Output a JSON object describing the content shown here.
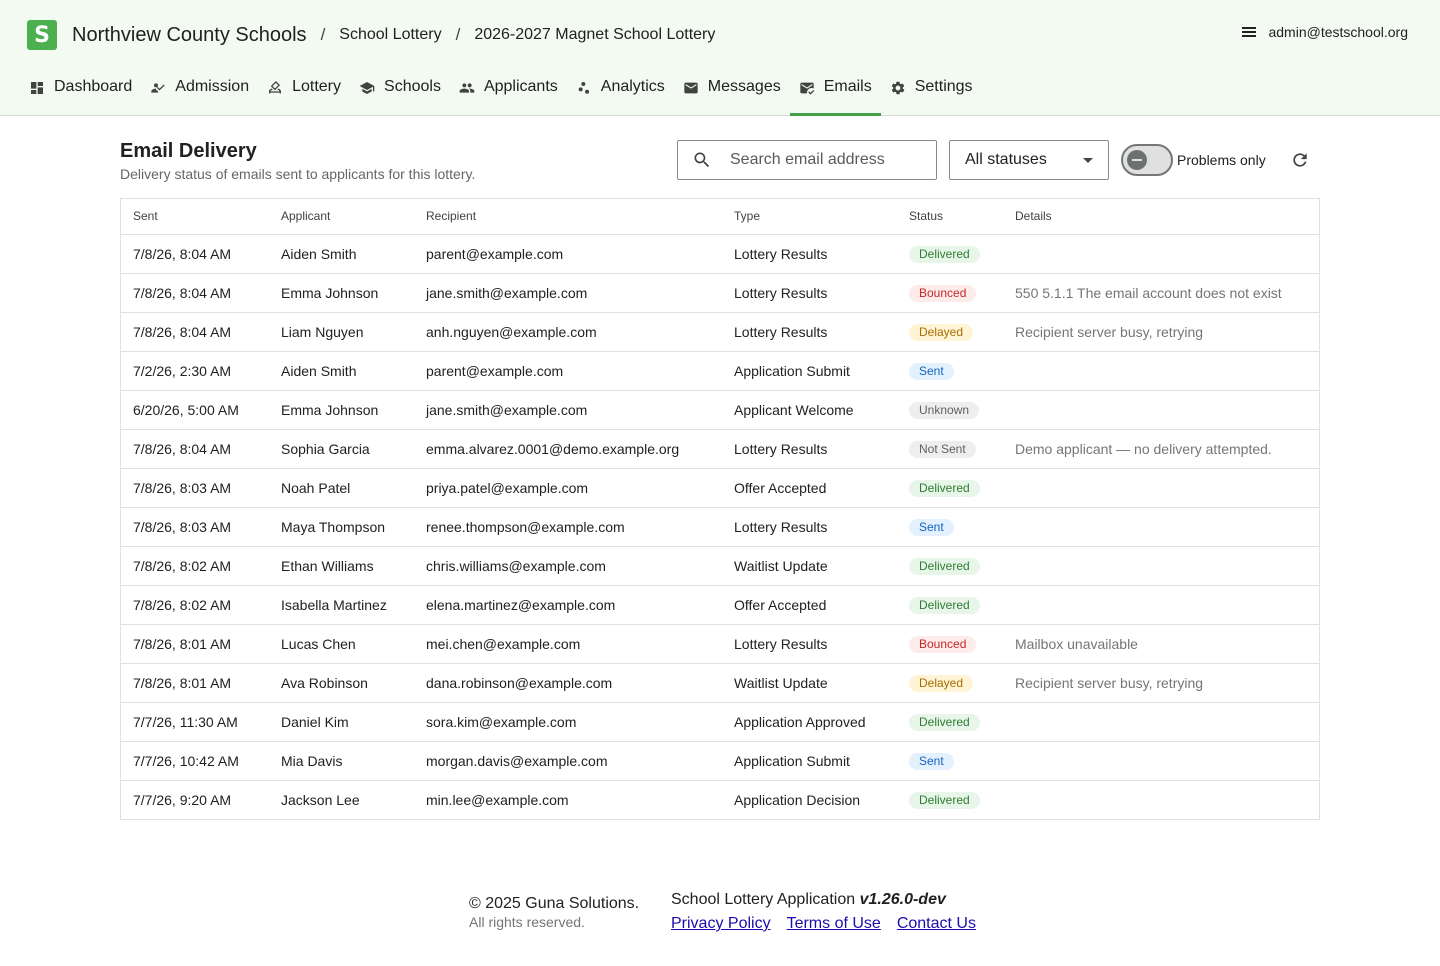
{
  "header": {
    "logo_letter": "S",
    "org_name": "Northview County Schools",
    "breadcrumb_sep": "/",
    "breadcrumbs": [
      "School Lottery",
      "2026-2027 Magnet School Lottery"
    ],
    "user_email": "admin@testschool.org"
  },
  "nav": {
    "items": [
      {
        "label": "Dashboard",
        "icon": "dashboard-icon"
      },
      {
        "label": "Admission",
        "icon": "admission-icon"
      },
      {
        "label": "Lottery",
        "icon": "lottery-icon"
      },
      {
        "label": "Schools",
        "icon": "school-icon"
      },
      {
        "label": "Applicants",
        "icon": "people-icon"
      },
      {
        "label": "Analytics",
        "icon": "analytics-icon"
      },
      {
        "label": "Messages",
        "icon": "mail-icon"
      },
      {
        "label": "Emails",
        "icon": "mark-email-read-icon"
      },
      {
        "label": "Settings",
        "icon": "gear-icon"
      }
    ],
    "active": "Emails",
    "active_color": "#43a047"
  },
  "main": {
    "title": "Email Delivery",
    "subtitle": "Delivery status of emails sent to applicants for this lottery.",
    "search_placeholder": "Search email address",
    "status_filter": "All statuses",
    "problems_only_label": "Problems only",
    "problems_only": false
  },
  "table": {
    "columns": [
      "Sent",
      "Applicant",
      "Recipient",
      "Type",
      "Status",
      "Details"
    ],
    "rows": [
      {
        "sent": "7/8/26, 8:04 AM",
        "applicant": "Aiden Smith",
        "recipient": "parent@example.com",
        "type": "Lottery Results",
        "status": "Delivered",
        "details": ""
      },
      {
        "sent": "7/8/26, 8:04 AM",
        "applicant": "Emma Johnson",
        "recipient": "jane.smith@example.com",
        "type": "Lottery Results",
        "status": "Bounced",
        "details": "550 5.1.1 The email account does not exist"
      },
      {
        "sent": "7/8/26, 8:04 AM",
        "applicant": "Liam Nguyen",
        "recipient": "anh.nguyen@example.com",
        "type": "Lottery Results",
        "status": "Delayed",
        "details": "Recipient server busy, retrying"
      },
      {
        "sent": "7/2/26, 2:30 AM",
        "applicant": "Aiden Smith",
        "recipient": "parent@example.com",
        "type": "Application Submit",
        "status": "Sent",
        "details": ""
      },
      {
        "sent": "6/20/26, 5:00 AM",
        "applicant": "Emma Johnson",
        "recipient": "jane.smith@example.com",
        "type": "Applicant Welcome",
        "status": "Unknown",
        "details": ""
      },
      {
        "sent": "7/8/26, 8:04 AM",
        "applicant": "Sophia Garcia",
        "recipient": "emma.alvarez.0001@demo.example.org",
        "type": "Lottery Results",
        "status": "Not Sent",
        "details": "Demo applicant — no delivery attempted."
      },
      {
        "sent": "7/8/26, 8:03 AM",
        "applicant": "Noah Patel",
        "recipient": "priya.patel@example.com",
        "type": "Offer Accepted",
        "status": "Delivered",
        "details": ""
      },
      {
        "sent": "7/8/26, 8:03 AM",
        "applicant": "Maya Thompson",
        "recipient": "renee.thompson@example.com",
        "type": "Lottery Results",
        "status": "Sent",
        "details": ""
      },
      {
        "sent": "7/8/26, 8:02 AM",
        "applicant": "Ethan Williams",
        "recipient": "chris.williams@example.com",
        "type": "Waitlist Update",
        "status": "Delivered",
        "details": ""
      },
      {
        "sent": "7/8/26, 8:02 AM",
        "applicant": "Isabella Martinez",
        "recipient": "elena.martinez@example.com",
        "type": "Offer Accepted",
        "status": "Delivered",
        "details": ""
      },
      {
        "sent": "7/8/26, 8:01 AM",
        "applicant": "Lucas Chen",
        "recipient": "mei.chen@example.com",
        "type": "Lottery Results",
        "status": "Bounced",
        "details": "Mailbox unavailable"
      },
      {
        "sent": "7/8/26, 8:01 AM",
        "applicant": "Ava Robinson",
        "recipient": "dana.robinson@example.com",
        "type": "Waitlist Update",
        "status": "Delayed",
        "details": "Recipient server busy, retrying"
      },
      {
        "sent": "7/7/26, 11:30 AM",
        "applicant": "Daniel Kim",
        "recipient": "sora.kim@example.com",
        "type": "Application Approved",
        "status": "Delivered",
        "details": ""
      },
      {
        "sent": "7/7/26, 10:42 AM",
        "applicant": "Mia Davis",
        "recipient": "morgan.davis@example.com",
        "type": "Application Submit",
        "status": "Sent",
        "details": ""
      },
      {
        "sent": "7/7/26, 9:20 AM",
        "applicant": "Jackson Lee",
        "recipient": "min.lee@example.com",
        "type": "Application Decision",
        "status": "Delivered",
        "details": ""
      }
    ],
    "status_colors": {
      "Delivered": {
        "bg": "#e8f5e9",
        "fg": "#2e7d32"
      },
      "Bounced": {
        "bg": "#fdecea",
        "fg": "#c62828"
      },
      "Delayed": {
        "bg": "#fff4d6",
        "fg": "#a86d00"
      },
      "Sent": {
        "bg": "#e3f0fd",
        "fg": "#1565c0"
      },
      "Unknown": {
        "bg": "#eeeeee",
        "fg": "#616161"
      },
      "Not Sent": {
        "bg": "#eeeeee",
        "fg": "#616161"
      }
    }
  },
  "footer": {
    "copyright": "© 2025 Guna Solutions.",
    "rights": "All rights reserved.",
    "app_name": "School Lottery Application",
    "version": "v1.26.0-dev",
    "links": [
      "Privacy Policy",
      "Terms of Use",
      "Contact Us"
    ]
  },
  "colors": {
    "header_bg": "#f3faf2",
    "brand": "#4caf50",
    "link": "#1a0dab"
  }
}
